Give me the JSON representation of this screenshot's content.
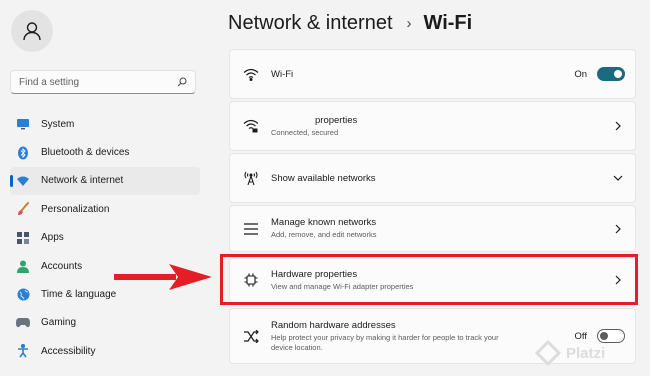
{
  "search": {
    "placeholder": "Find a setting"
  },
  "sidebar": {
    "items": [
      {
        "label": "System",
        "icon": "monitor-icon"
      },
      {
        "label": "Bluetooth & devices",
        "icon": "bluetooth-icon"
      },
      {
        "label": "Network & internet",
        "icon": "wifi-diamond-icon",
        "active": true
      },
      {
        "label": "Personalization",
        "icon": "paintbrush-icon"
      },
      {
        "label": "Apps",
        "icon": "apps-icon"
      },
      {
        "label": "Accounts",
        "icon": "person-icon"
      },
      {
        "label": "Time & language",
        "icon": "globe-icon"
      },
      {
        "label": "Gaming",
        "icon": "gamepad-icon"
      },
      {
        "label": "Accessibility",
        "icon": "accessibility-icon"
      }
    ]
  },
  "header": {
    "parent": "Network & internet",
    "separator": "›",
    "current": "Wi-Fi"
  },
  "cards": {
    "wifi": {
      "title": "Wi-Fi",
      "state": "On"
    },
    "properties": {
      "title": "properties",
      "subtitle": "Connected, secured"
    },
    "available": {
      "title": "Show available networks"
    },
    "known": {
      "title": "Manage known networks",
      "subtitle": "Add, remove, and edit networks"
    },
    "hardware": {
      "title": "Hardware properties",
      "subtitle": "View and manage Wi-Fi adapter properties"
    },
    "random": {
      "title": "Random hardware addresses",
      "subtitle": "Help protect your privacy by making it harder for people to track your device location.",
      "state": "Off"
    }
  },
  "watermark": {
    "text": "Platzi"
  },
  "colors": {
    "accent": "#0067c0",
    "toggle_on": "#1b6a80",
    "highlight": "#e31e24"
  }
}
